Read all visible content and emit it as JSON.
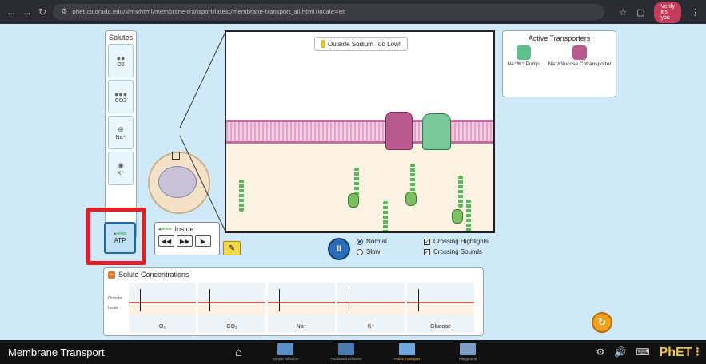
{
  "browser": {
    "url": "phet.colorado.edu/sims/html/membrane-transport/latest/membrane-transport_all.html?locale=en",
    "profile_label": "Verify it's you"
  },
  "solutes_panel": {
    "title": "Solutes",
    "items": [
      {
        "label": "O2",
        "symbol": "●●"
      },
      {
        "label": "CO2",
        "symbol": "●●●"
      },
      {
        "label": "Na⁺",
        "symbol": "⊕"
      },
      {
        "label": "K⁺",
        "symbol": "◉"
      },
      {
        "label": "ATP",
        "symbol": "●≡≡≡"
      }
    ]
  },
  "inside_panel": {
    "label": "Inside",
    "symbol": "●≡≡≡",
    "controls": [
      "◀◀",
      "▶▶",
      "▶"
    ]
  },
  "view": {
    "warning": "Outside Sodium Too Low!",
    "warning_color": "#e6c21a"
  },
  "transport_key": {
    "title": "Active Transporters",
    "items": [
      {
        "label": "Na⁺/K⁺ Pump",
        "color": "#5fbf8a"
      },
      {
        "label": "Na⁺/Glucose Cotransporter",
        "color": "#b85a8e"
      }
    ]
  },
  "playback": {
    "pause_symbol": "II",
    "speed_options": [
      "Normal",
      "Slow"
    ],
    "selected_speed": "Normal",
    "checkboxes": [
      {
        "label": "Crossing Highlights",
        "checked": true
      },
      {
        "label": "Crossing Sounds",
        "checked": true
      }
    ]
  },
  "concentrations": {
    "title": "Solute Concentrations",
    "collapse_symbol": "−",
    "row_labels": [
      "Outside",
      "Inside"
    ],
    "columns": [
      {
        "name": "O₂"
      },
      {
        "name": "CO₂"
      },
      {
        "name": "Na⁺"
      },
      {
        "name": "K⁺"
      },
      {
        "name": "Glucose"
      }
    ]
  },
  "reset_symbol": "↻",
  "navbar": {
    "title": "Membrane Transport",
    "screens": [
      {
        "label": "Simple Diffusion",
        "active": false,
        "color": "#5b8fc7"
      },
      {
        "label": "Facilitated Diffusion",
        "active": false,
        "color": "#4c7ab3"
      },
      {
        "label": "Active Transport",
        "active": true,
        "color": "#6fa8dc"
      },
      {
        "label": "Playground",
        "active": false,
        "color": "#7e9fc5"
      }
    ],
    "logo_prefix": "PhET",
    "logo_suffix": " ⁝"
  },
  "accent_colors": {
    "highlight_red": "#e31e24",
    "reset_orange": "#f0a020",
    "play_blue": "#2a6cb5"
  }
}
